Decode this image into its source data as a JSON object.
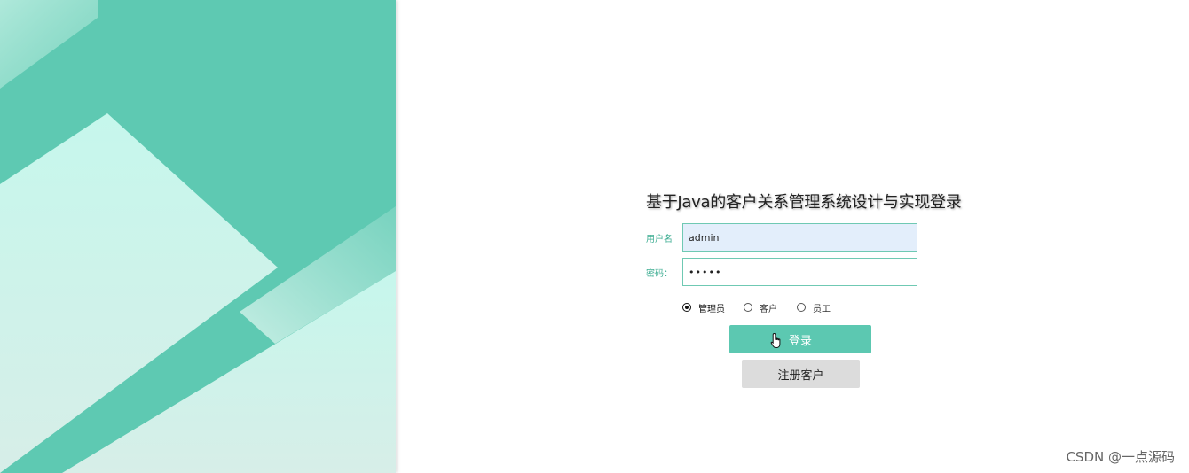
{
  "login": {
    "title": "基于Java的客户关系管理系统设计与实现登录",
    "username_label": "用户名",
    "username_value": "admin",
    "password_label": "密码：",
    "password_value": "•••••",
    "roles": [
      {
        "label": "管理员",
        "selected": true
      },
      {
        "label": "客户",
        "selected": false
      },
      {
        "label": "员工",
        "selected": false
      }
    ],
    "login_button": "登录",
    "register_button": "注册客户"
  },
  "watermark": "CSDN @一点源码",
  "colors": {
    "brand": "#5cc8b1",
    "panel_dark": "#5ec9b2",
    "panel_light": "#c4f5ea",
    "label": "#3fae93",
    "input_highlight": "#e3eefb",
    "register_bg": "#dcdcdc"
  },
  "icons": {
    "cursor": "hand-pointer-icon"
  }
}
